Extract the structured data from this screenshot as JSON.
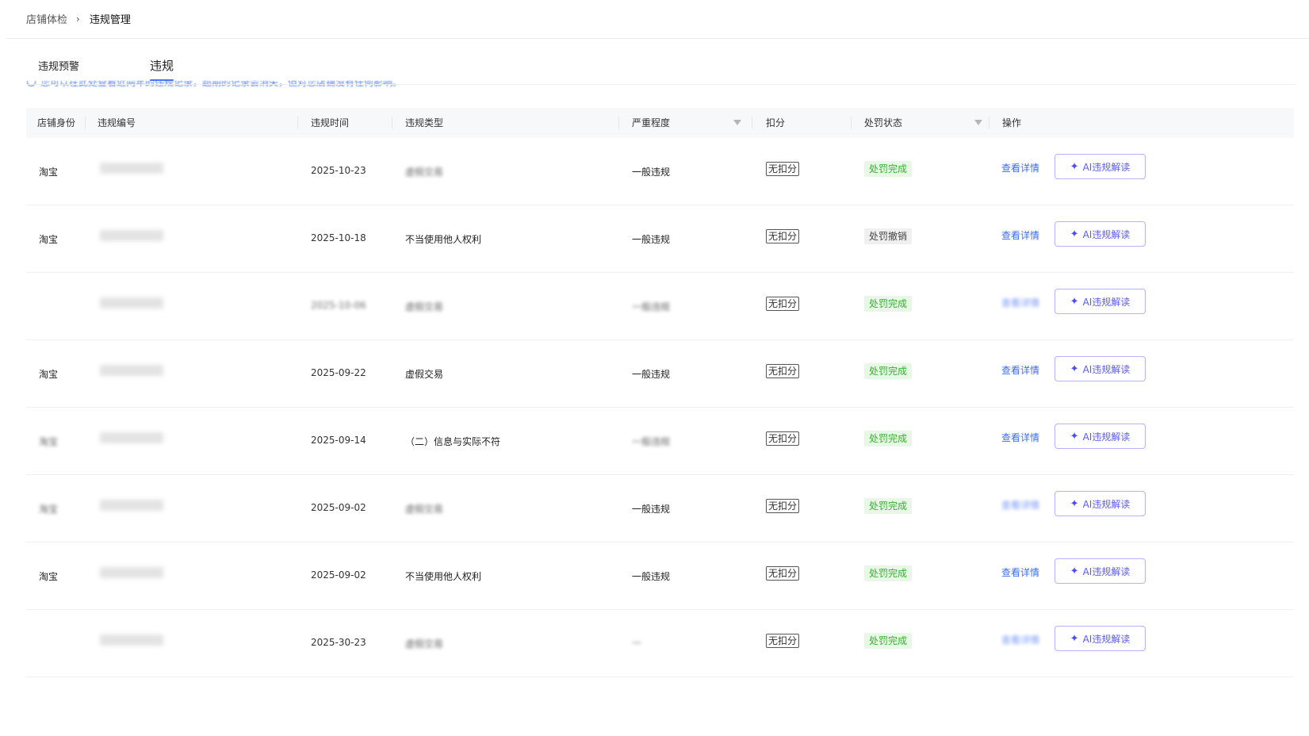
{
  "breadcrumb": {
    "parent": "店铺体检",
    "separator": "›",
    "current": "违规管理"
  },
  "tabs": [
    {
      "label": "违规预警"
    },
    {
      "label": "违规"
    }
  ],
  "notice": {
    "text": "您可以在此处查看近两年的违规记录，超期的记录会消失，但对您店铺没有任何影响。"
  },
  "table": {
    "headers": {
      "shop": "店铺身份",
      "id": "违规编号",
      "time": "违规时间",
      "type": "违规类型",
      "severity": "严重程度",
      "deduction": "扣分",
      "status": "处罚状态",
      "action": "操作"
    },
    "rows": [
      {
        "shop": "淘宝",
        "time": "2025-10-23",
        "type": "虚假交易",
        "severity": "一般违规",
        "deduction": "无扣分",
        "status": "处罚完成",
        "status_kind": "done",
        "detail": "查看详情",
        "ai": "AI违规解读"
      },
      {
        "shop": "淘宝",
        "time": "2025-10-18",
        "type": "不当使用他人权利",
        "severity": "一般违规",
        "deduction": "无扣分",
        "status": "处罚撤销",
        "status_kind": "revoked",
        "detail": "查看详情",
        "ai": "AI违规解读"
      },
      {
        "shop": "",
        "time": "2025-10-06",
        "type": "虚假交易",
        "severity": "一般违规",
        "deduction": "无扣分",
        "status": "处罚完成",
        "status_kind": "done",
        "detail": "查看详情",
        "ai": "AI违规解读"
      },
      {
        "shop": "淘宝",
        "time": "2025-09-22",
        "type": "虚假交易",
        "severity": "一般违规",
        "deduction": "无扣分",
        "status": "处罚完成",
        "status_kind": "done",
        "detail": "查看详情",
        "ai": "AI违规解读"
      },
      {
        "shop": "淘宝",
        "time": "2025-09-14",
        "type": "（二）信息与实际不符",
        "severity": "一般违规",
        "deduction": "无扣分",
        "status": "处罚完成",
        "status_kind": "done",
        "detail": "查看详情",
        "ai": "AI违规解读"
      },
      {
        "shop": "淘宝",
        "time": "2025-09-02",
        "type": "虚假交易",
        "severity": "一般违规",
        "deduction": "无扣分",
        "status": "处罚完成",
        "status_kind": "done",
        "detail": "查看详情",
        "ai": "AI违规解读"
      },
      {
        "shop": "淘宝",
        "time": "2025-09-02",
        "type": "不当使用他人权利",
        "severity": "一般违规",
        "deduction": "无扣分",
        "status": "处罚完成",
        "status_kind": "done",
        "detail": "查看详情",
        "ai": "AI违规解读"
      },
      {
        "shop": "",
        "time": "2025-30-23",
        "type": "虚假交易",
        "severity": "—",
        "deduction": "无扣分",
        "status": "处罚完成",
        "status_kind": "done",
        "detail": "查看详情",
        "ai": "AI违规解读"
      }
    ]
  },
  "icons": {
    "filter": "filter-icon",
    "spark": "sparkle-icon",
    "info": "info-icon",
    "chevron": "chevron-right-icon"
  },
  "colors": {
    "accent": "#4a74ff",
    "link": "#3b6cf6",
    "success_text": "#2fb62a",
    "success_bg": "#e8f7e6",
    "ai_border": "#b7b1ff",
    "ai_text": "#5b5bf0"
  }
}
